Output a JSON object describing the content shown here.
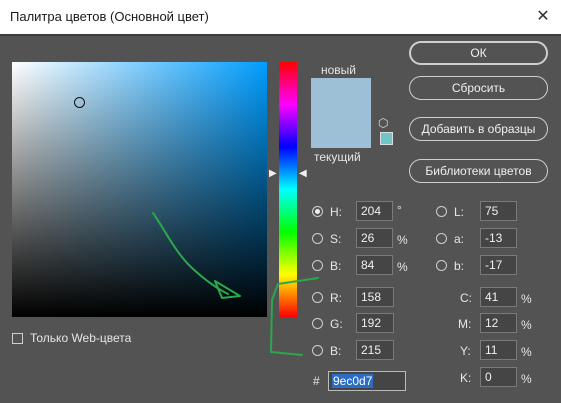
{
  "window": {
    "title": "Палитра цветов (Основной цвет)",
    "close_symbol": "✕"
  },
  "preview": {
    "new_label": "новый",
    "current_label": "текущий",
    "new_color": "#9ec0d7",
    "current_color": "#9ec0d7"
  },
  "buttons": {
    "ok": "ОК",
    "reset": "Сбросить",
    "add_to_swatches": "Добавить в образцы",
    "color_libraries": "Библиотеки цветов"
  },
  "hsb": {
    "h": {
      "label": "H:",
      "value": "204",
      "unit": "°"
    },
    "s": {
      "label": "S:",
      "value": "26",
      "unit": "%"
    },
    "b": {
      "label": "B:",
      "value": "84",
      "unit": "%"
    }
  },
  "lab": {
    "l": {
      "label": "L:",
      "value": "75"
    },
    "a": {
      "label": "a:",
      "value": "-13"
    },
    "b": {
      "label": "b:",
      "value": "-17"
    }
  },
  "rgb": {
    "r": {
      "label": "R:",
      "value": "158"
    },
    "g": {
      "label": "G:",
      "value": "192"
    },
    "b": {
      "label": "B:",
      "value": "215"
    }
  },
  "cmyk": {
    "c": {
      "label": "C:",
      "value": "41",
      "unit": "%"
    },
    "m": {
      "label": "M:",
      "value": "12",
      "unit": "%"
    },
    "y": {
      "label": "Y:",
      "value": "11",
      "unit": "%"
    },
    "k": {
      "label": "K:",
      "value": "0",
      "unit": "%"
    }
  },
  "hex": {
    "label": "#",
    "value": "9ec0d7"
  },
  "web_only": {
    "label": "Только Web-цвета"
  },
  "colors": {
    "background": "#535353",
    "annotation": "#2aa84a",
    "selection": "#2b6cc4"
  }
}
